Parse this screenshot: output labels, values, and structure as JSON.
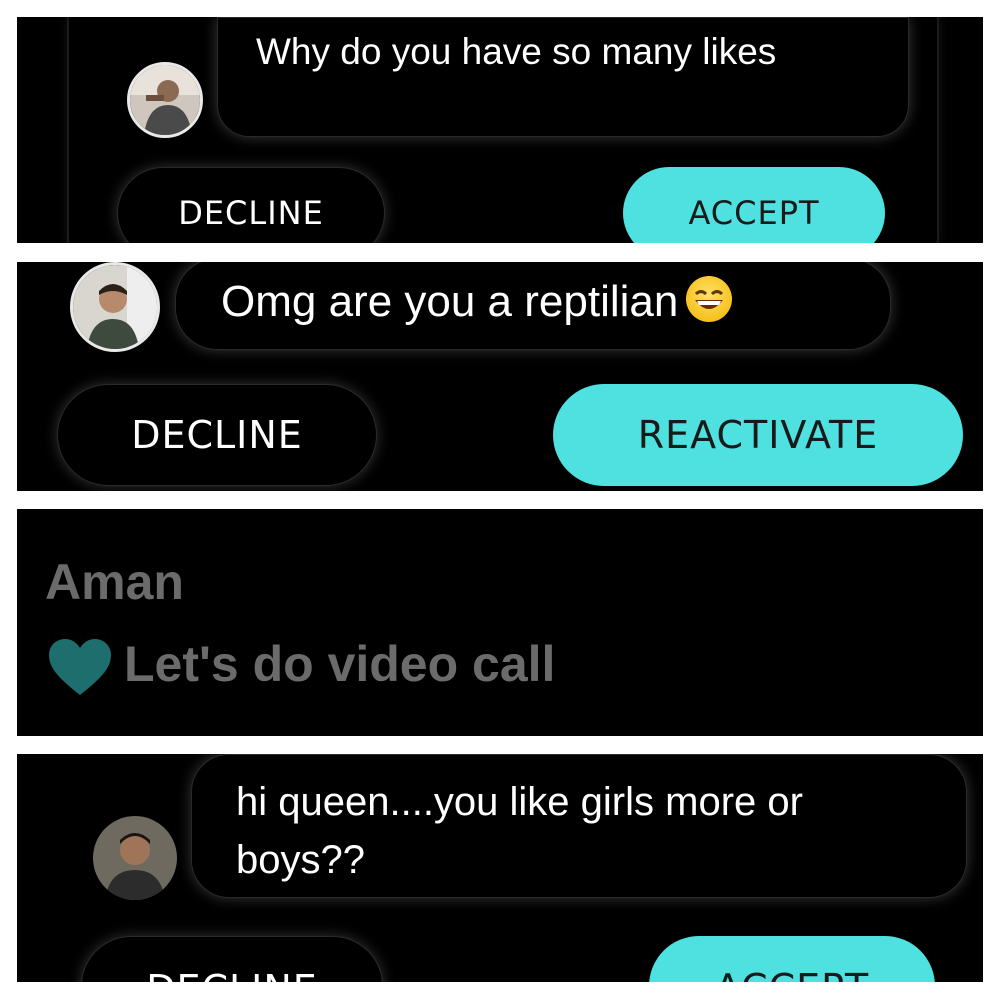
{
  "panels": [
    {
      "message": "Why do you have so many likes",
      "decline_label": "DECLINE",
      "action_label": "ACCEPT"
    },
    {
      "message": "Omg are you a reptilian",
      "emoji": "grinning-face-emoji",
      "decline_label": "DECLINE",
      "action_label": "REACTIVATE"
    },
    {
      "name": "Aman",
      "message": "Let's do video call",
      "icon": "heart-icon"
    },
    {
      "message": "hi queen....you like girls more or boys??",
      "decline_label": "DECLINE",
      "action_label": "ACCEPT"
    }
  ],
  "colors": {
    "background": "#000000",
    "accent": "#4fe0e0",
    "muted_text": "#6b6b6b",
    "heart": "#1e6e6e",
    "separator": "#ffffff"
  }
}
